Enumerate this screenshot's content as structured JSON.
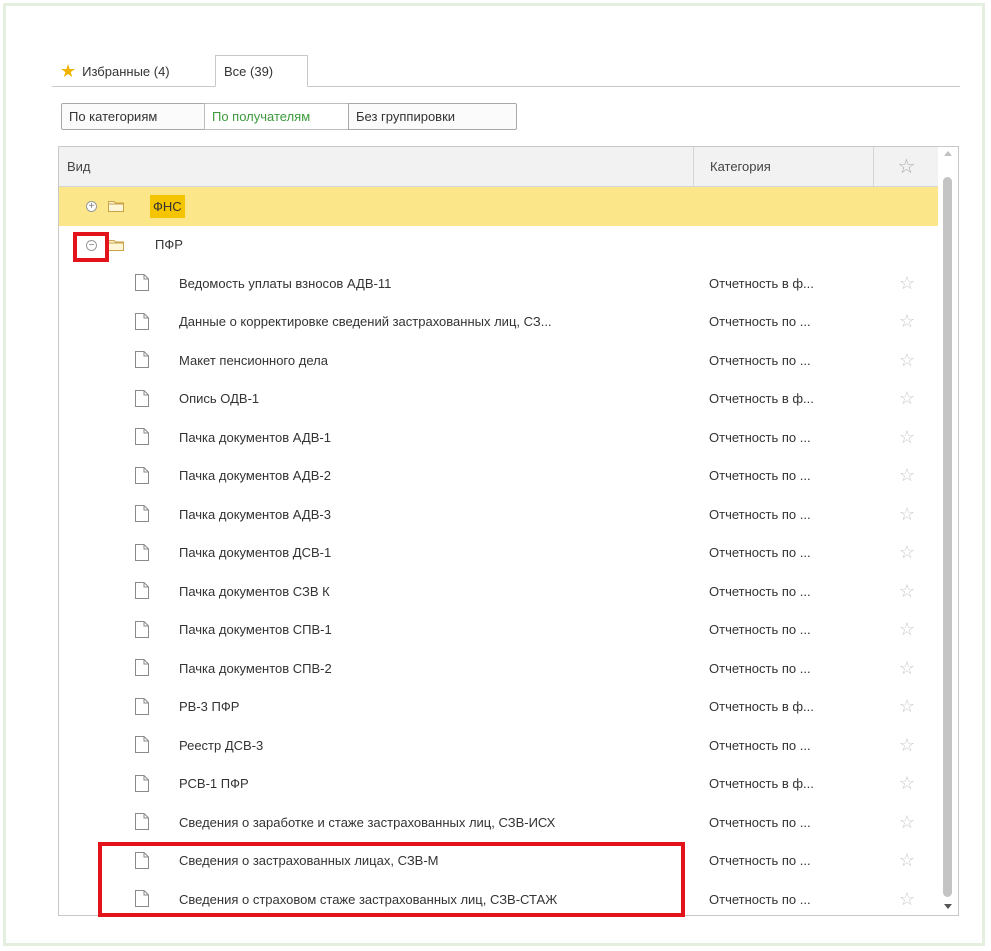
{
  "tabs": [
    {
      "label": "Избранные (4)",
      "icon": "star-icon"
    },
    {
      "label": "Все (39)"
    }
  ],
  "grouping": {
    "by_category": "По категориям",
    "by_recipient": "По получателям",
    "no_grouping": "Без группировки",
    "active": "По получателям"
  },
  "table": {
    "headers": {
      "vid": "Вид",
      "category": "Категория",
      "favorite_icon": "star-icon"
    },
    "groups": [
      {
        "name": "ФНС",
        "expanded": false
      },
      {
        "name": "ПФР",
        "expanded": true
      }
    ],
    "rows": [
      {
        "name": "Ведомость уплаты взносов АДВ-11",
        "category": "Отчетность в ф..."
      },
      {
        "name": "Данные о корректировке сведений застрахованных лиц, СЗ...",
        "category": "Отчетность по ..."
      },
      {
        "name": "Макет пенсионного дела",
        "category": "Отчетность по ..."
      },
      {
        "name": "Опись ОДВ-1",
        "category": "Отчетность в ф..."
      },
      {
        "name": "Пачка документов АДВ-1",
        "category": "Отчетность по ..."
      },
      {
        "name": "Пачка документов АДВ-2",
        "category": "Отчетность по ..."
      },
      {
        "name": "Пачка документов АДВ-3",
        "category": "Отчетность по ..."
      },
      {
        "name": "Пачка документов ДСВ-1",
        "category": "Отчетность по ..."
      },
      {
        "name": "Пачка документов СЗВ К",
        "category": "Отчетность по ..."
      },
      {
        "name": "Пачка документов СПВ-1",
        "category": "Отчетность по ..."
      },
      {
        "name": "Пачка документов СПВ-2",
        "category": "Отчетность по ..."
      },
      {
        "name": "РВ-3 ПФР",
        "category": "Отчетность в ф..."
      },
      {
        "name": "Реестр ДСВ-3",
        "category": "Отчетность по ..."
      },
      {
        "name": "РСВ-1 ПФР",
        "category": "Отчетность в ф..."
      },
      {
        "name": "Сведения о заработке и стаже застрахованных лиц, СЗВ-ИСХ",
        "category": "Отчетность по ..."
      },
      {
        "name": "Сведения о застрахованных лицах, СЗВ-М",
        "category": "Отчетность по ..."
      },
      {
        "name": "Сведения о страховом стаже застрахованных лиц, СЗВ-СТАЖ",
        "category": "Отчетность по ..."
      }
    ]
  },
  "colors": {
    "accent_green": "#3b9b3b",
    "highlight_yellow": "#f4c400",
    "row_highlight": "#fbe68a",
    "annotation_red": "#e3131b",
    "star_gold": "#f0b400"
  }
}
